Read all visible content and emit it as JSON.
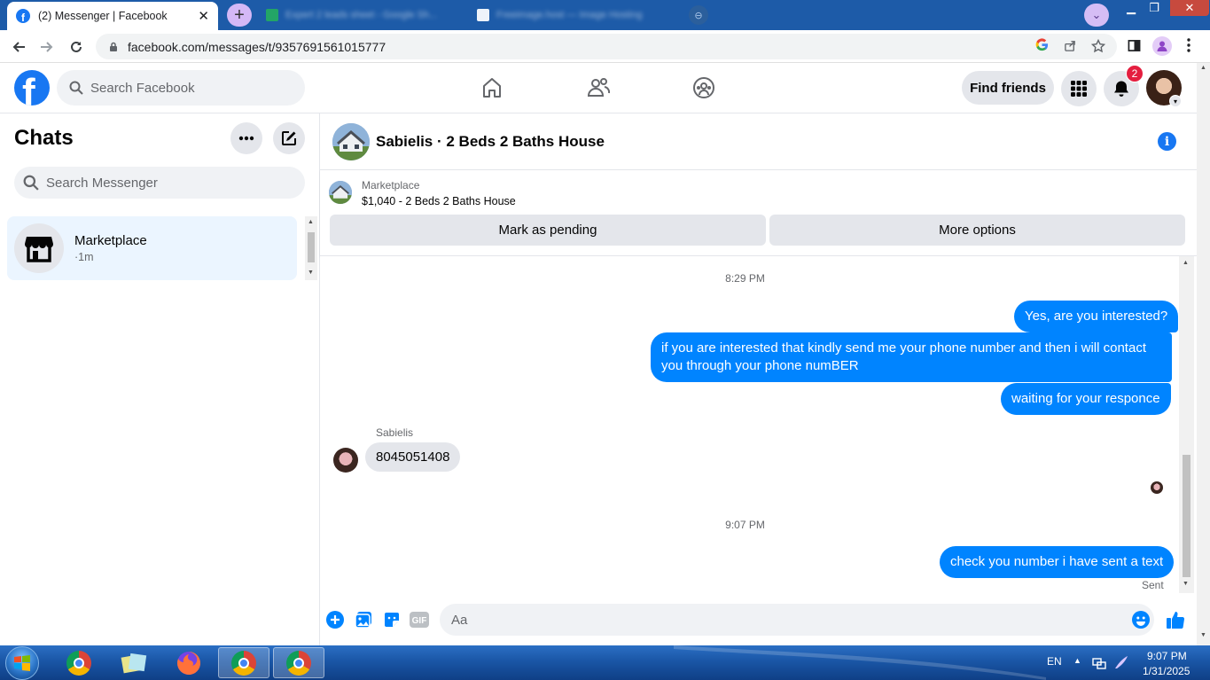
{
  "browser": {
    "active_tab_title": "(2) Messenger | Facebook",
    "active_tab_close": "✕",
    "new_tab_label": "+",
    "tab2_title": "Expert 2 leads sheet - Google Sh...",
    "tab3_title": "Freeimage.host — Image Hosting",
    "tab_more_label": "⊖",
    "profile_chevron": "⌄",
    "url": "facebook.com/messages/t/9357691561015777",
    "win_min": "▁",
    "win_max": "❐",
    "win_close": "✕"
  },
  "fb_header": {
    "logo_letter": "f",
    "search_placeholder": "Search Facebook",
    "find_friends": "Find friends",
    "notification_count": "2"
  },
  "sidebar": {
    "title": "Chats",
    "search_placeholder": "Search Messenger",
    "chats": [
      {
        "name": "Marketplace",
        "time": "·1m"
      }
    ]
  },
  "conversation": {
    "title": "Sabielis · 2 Beds 2 Baths House",
    "info_label": "i",
    "marketplace_label": "Marketplace",
    "listing": "$1,040 - 2 Beds 2 Baths House",
    "mark_pending": "Mark as pending",
    "more_options": "More options",
    "timestamp1": "8:29 PM",
    "out_msg1": "Yes, are you interested?",
    "out_msg2": "if you are interested that kindly send me your phone number and then i will contact you through your phone numBER",
    "out_msg3": "waiting for your responce",
    "sender_name": "Sabielis",
    "in_msg1": "8045051408",
    "timestamp2": "9:07 PM",
    "out_msg4": "check you number i have sent a text",
    "status": "Sent",
    "composer_placeholder": "Aa"
  },
  "taskbar": {
    "lang": "EN",
    "time": "9:07 PM",
    "date": "1/31/2025"
  },
  "colors": {
    "fb_blue": "#1877f2",
    "bubble_out": "#0084ff",
    "bubble_in": "#e4e6eb",
    "selected_chat": "#ebf5ff",
    "chrome_tabbar": "#1d5ba8"
  }
}
